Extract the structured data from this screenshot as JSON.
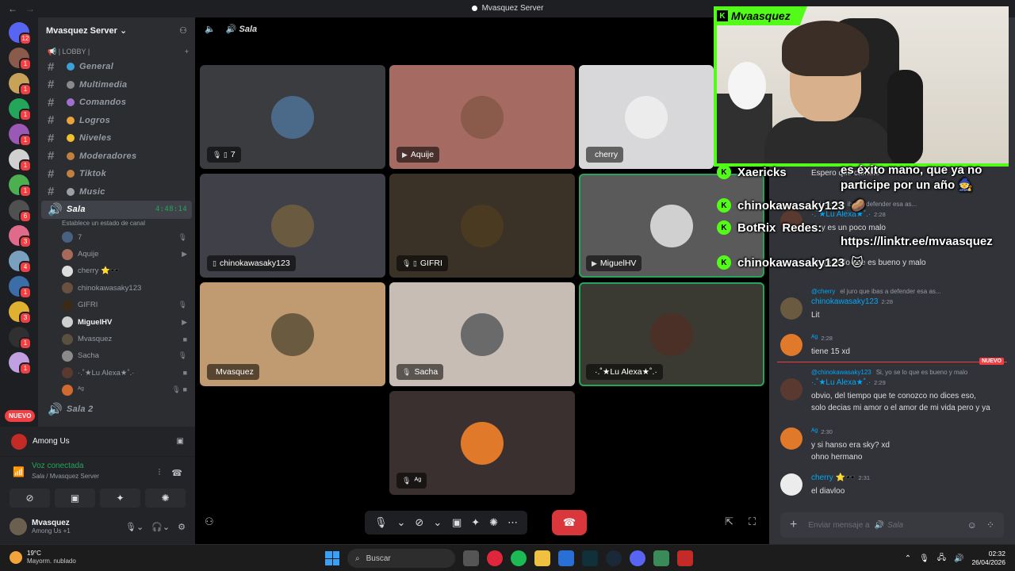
{
  "window": {
    "title": "Mvasquez Server",
    "back": "←",
    "forward": "→"
  },
  "servers": {
    "items": [
      {
        "color": "#5865f2",
        "badge": "12"
      },
      {
        "color": "#8a5a4a",
        "badge": "1"
      },
      {
        "color": "#c9a25a",
        "badge": "1"
      },
      {
        "color": "#23a55a",
        "badge": "1"
      },
      {
        "color": "#9b59b6",
        "badge": "1"
      },
      {
        "color": "#d0d0d0",
        "badge": "1"
      },
      {
        "color": "#4caf50",
        "badge": "1"
      },
      {
        "color": "#505050",
        "badge": "6"
      },
      {
        "color": "#e06a8a",
        "badge": "3"
      },
      {
        "color": "#7aa0c0",
        "badge": "4"
      },
      {
        "color": "#3b6ea8",
        "badge": "1"
      },
      {
        "color": "#e0b030",
        "badge": "3"
      },
      {
        "color": "#303030",
        "badge": "1"
      },
      {
        "color": "#c0a0e0",
        "badge": "1"
      }
    ],
    "nuevo": "NUEVO"
  },
  "sidebar": {
    "server_name": "Mvasquez Server",
    "category": "📢 | LOBBY |",
    "channels": [
      {
        "label": "General",
        "color": "#3ba1d8"
      },
      {
        "label": "Multimedia",
        "color": "#8a8a8a"
      },
      {
        "label": "Comandos",
        "color": "#a070d0"
      },
      {
        "label": "Logros",
        "color": "#e8a33a"
      },
      {
        "label": "Niveles",
        "color": "#f0c030"
      },
      {
        "label": "Moderadores",
        "color": "#c08040"
      },
      {
        "label": "Tiktok",
        "color": "#c08040"
      },
      {
        "label": "Music",
        "color": "#9aa0a6"
      }
    ],
    "voice_channel": {
      "label": "Sala",
      "timer": "4:48:14",
      "status_hint": "Establece un estado de canal"
    },
    "voice_users": [
      {
        "name": "7",
        "color": "#4a6080",
        "icon": "🎙"
      },
      {
        "name": "Aquije",
        "color": "#a56a5a",
        "icon": "▶"
      },
      {
        "name": "cherry ⭐🕶️",
        "color": "#ddd",
        "icon": ""
      },
      {
        "name": "chinokawasaky123",
        "color": "#6a5040",
        "icon": ""
      },
      {
        "name": "GIFRI",
        "color": "#3a2a1a",
        "icon": "🎙"
      },
      {
        "name": "MiguelHV",
        "color": "#cfcfcf",
        "icon": "▶"
      },
      {
        "name": "Mvasquez",
        "color": "#5a5040",
        "icon": "■"
      },
      {
        "name": "Sacha",
        "color": "#8a8a8a",
        "icon": "🎙"
      },
      {
        "name": "·.˚★Lu Alexa★˚.·",
        "color": "#5a3a30",
        "icon": "■"
      },
      {
        "name": "ᴬᵍ",
        "color": "#d06a30",
        "icon": "🎙 ■"
      }
    ],
    "voice_channel_2": "Sala 2"
  },
  "voice_panel": {
    "activity": "Among Us",
    "connected": "Voz conectada",
    "channel_path_channel": "Sala",
    "channel_path_server": "/ Mvasquez Server",
    "user_name": "Mvasquez",
    "user_status": "Among Us +1"
  },
  "call": {
    "channel": "Sala",
    "tiles": [
      {
        "name": "7",
        "bg": "#3a3c3f",
        "avatar": "#4b6a8a",
        "icons": "🎙 ▯",
        "speaking": false
      },
      {
        "name": "Aquije",
        "bg": "#a56a62",
        "avatar": "#8a5a4a",
        "icons": "▶",
        "speaking": false
      },
      {
        "name": "cherry",
        "bg": "#d8d8da",
        "avatar": "#ececec",
        "icons": "",
        "speaking": false
      },
      {
        "name": "chinokawasaky123",
        "bg": "#404048",
        "avatar": "#6a5a40",
        "icons": "▯",
        "speaking": false
      },
      {
        "name": "GIFRI",
        "bg": "#3a3226",
        "avatar": "#4a3a22",
        "icons": "🎙 ▯",
        "speaking": false
      },
      {
        "name": "MiguelHV",
        "bg": "#5a5a5a",
        "avatar": "#d0d0d0",
        "icons": "▶",
        "speaking": true
      },
      {
        "name": "Mvasquez",
        "bg": "#c09a70",
        "avatar": "#6a5a40",
        "icons": "",
        "speaking": false
      },
      {
        "name": "Sacha",
        "bg": "#c8bdb4",
        "avatar": "#6a6a6a",
        "icons": "🎙",
        "speaking": false
      },
      {
        "name": "·.˚★Lu Alexa★˚.·",
        "bg": "#3a3a32",
        "avatar": "#4a3026",
        "icons": "",
        "speaking": true
      },
      {
        "name": "ᴬᵍ",
        "bg": "#3a3030",
        "avatar": "#e07a2a",
        "icons": "🎙",
        "speaking": false
      }
    ]
  },
  "overlay": {
    "streamer": "Mvaasquez",
    "lines": [
      {
        "user": "Xaericks",
        "text": ""
      },
      {
        "user": "chinokawasaky123",
        "text": "🥔"
      },
      {
        "user": "BotRix",
        "text": "Redes:"
      },
      {
        "user": "",
        "text": "https://linktr.ee/mvaasquez"
      },
      {
        "user": "chinokawasaky123",
        "text": "🐱"
      }
    ],
    "top_msg_1": "es éxito mano, que ya no",
    "top_msg_2": "participe por un año 🧙"
  },
  "chat": {
    "input_placeholder": "Enviar mensaje a",
    "input_channel": "Sala",
    "new_tag": "NUEVO",
    "messages": [
      {
        "reply": "",
        "reply_text": "",
        "name": "",
        "time": "",
        "text": "Espero que cambie",
        "color": "#5a5a6a"
      },
      {
        "reply": "",
        "reply_text": "el juro que ibas a defender esa as...",
        "name": "·.˚★Lu Alexa★˚.·",
        "time": "2:28",
        "text": "si, y es un poco malo",
        "color": "#5a3a30"
      },
      {
        "reply": "",
        "reply_text": "",
        "name": "",
        "time": "",
        "text": "Si, yo se lo que es bueno y malo",
        "color": "#5a3a30"
      },
      {
        "reply": "@cherry",
        "reply_text": "el juro que ibas a defender esa as...",
        "name": "chinokawasaky123",
        "time": "2:28",
        "text": "Lit",
        "color": "#6a5a40"
      },
      {
        "reply": "",
        "reply_text": "",
        "name": "ᴬᵍ",
        "time": "2:28",
        "text": "tiene 15 xd",
        "color": "#e07a2a"
      },
      {
        "reply": "@chinokawasaky123",
        "reply_text": "Si, yo se lo que es bueno y malo",
        "name": "·.˚★Lu Alexa★˚.·",
        "time": "2:29",
        "text": "obvio, del tiempo que te conozco no dices eso,",
        "text2": "solo decias mi amor o el amor de mi vida pero y ya",
        "color": "#5a3a30"
      },
      {
        "reply": "",
        "reply_text": "",
        "name": "ᴬᵍ",
        "time": "2:30",
        "text": "y si hanso era sky? xd",
        "text2": "ohno hermano",
        "color": "#e07a2a"
      },
      {
        "reply": "",
        "reply_text": "",
        "name": "cherry ⭐🕶️",
        "time": "2:31",
        "text": "el diavloo",
        "color": "#ececec"
      }
    ]
  },
  "taskbar": {
    "temp": "19°C",
    "weather": "Mayorm. nublado",
    "search": "Buscar",
    "time": "02:32",
    "date": "26/04/2026"
  }
}
